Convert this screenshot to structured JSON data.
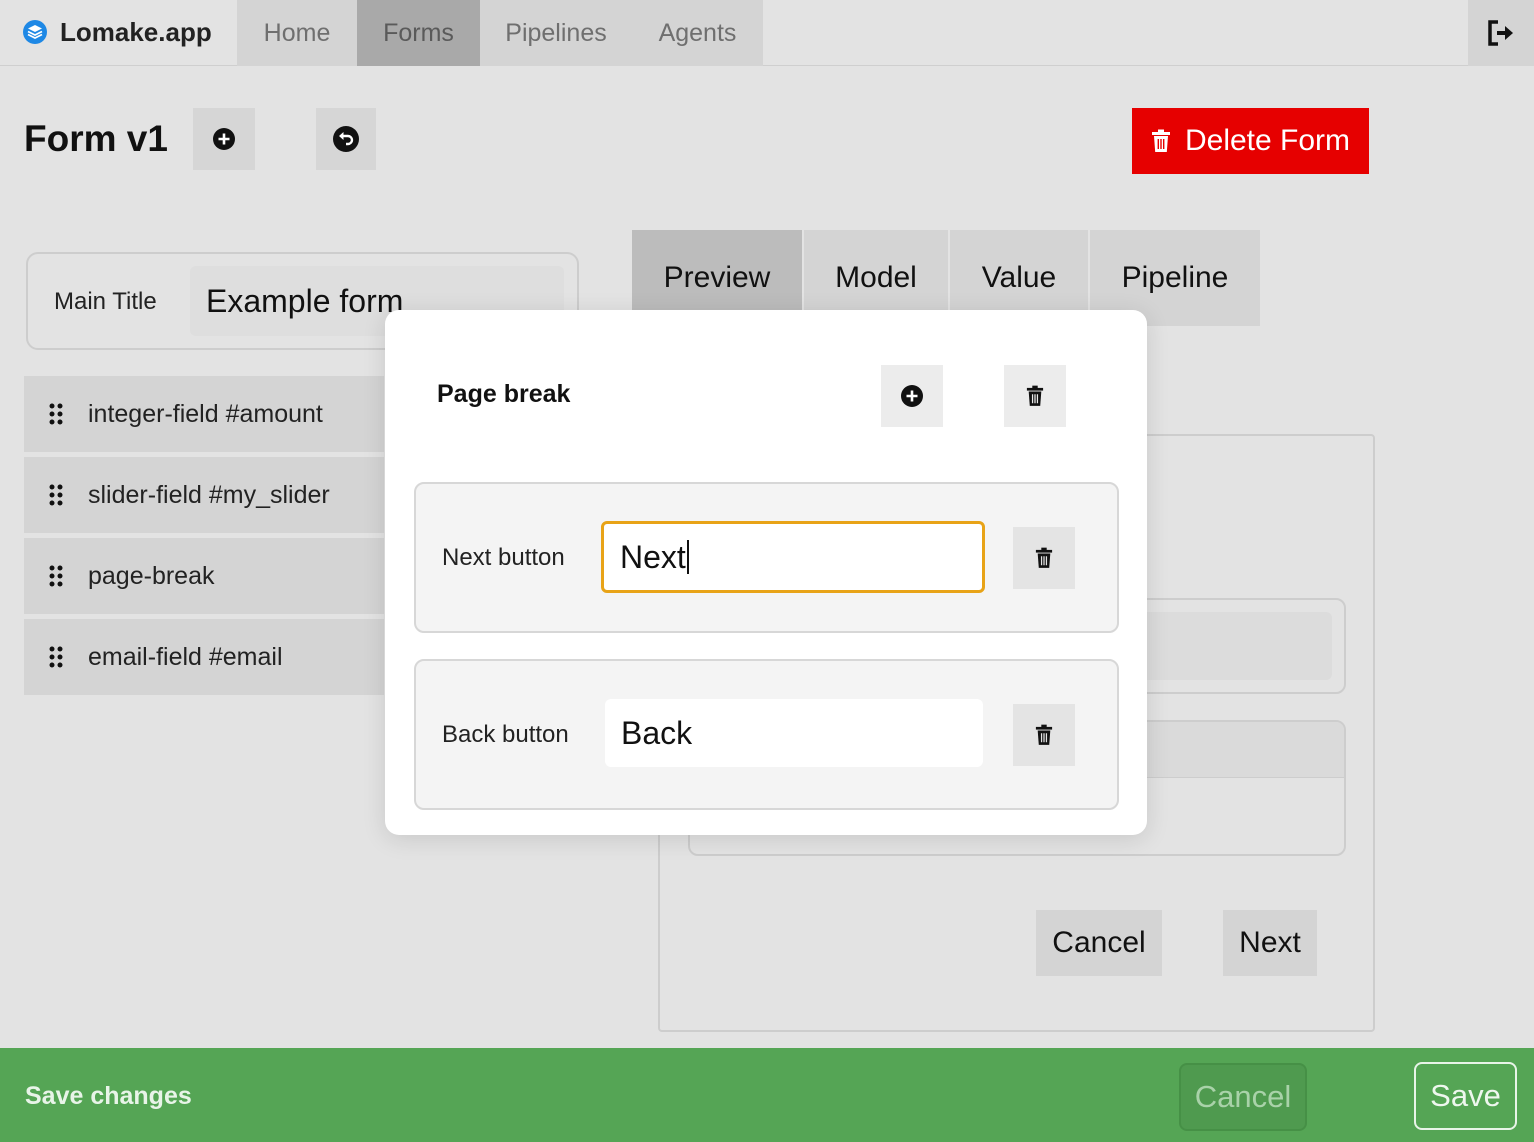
{
  "app": {
    "name": "Lomake.app",
    "logo_icon": "layers-icon"
  },
  "nav": {
    "items": [
      {
        "label": "Home",
        "active": false
      },
      {
        "label": "Forms",
        "active": true
      },
      {
        "label": "Pipelines",
        "active": false
      },
      {
        "label": "Agents",
        "active": false
      }
    ],
    "logout_icon": "logout-icon"
  },
  "header": {
    "title": "Form v1",
    "add_icon": "plus-circle-icon",
    "undo_icon": "undo-icon",
    "delete_label": "Delete Form",
    "delete_icon": "trash-icon",
    "delete_color": "#e60000"
  },
  "form": {
    "main_title_label": "Main Title",
    "main_title_value": "Example form",
    "fields": [
      {
        "label": "integer-field #amount"
      },
      {
        "label": "slider-field #my_slider"
      },
      {
        "label": "page-break"
      },
      {
        "label": "email-field #email"
      }
    ]
  },
  "tabs": [
    {
      "label": "Preview",
      "active": true
    },
    {
      "label": "Model",
      "active": false
    },
    {
      "label": "Value",
      "active": false
    },
    {
      "label": "Pipeline",
      "active": false
    }
  ],
  "preview": {
    "cancel_label": "Cancel",
    "next_label": "Next"
  },
  "modal": {
    "title": "Page break",
    "next_row": {
      "label": "Next button",
      "value": "Next"
    },
    "back_row": {
      "label": "Back button",
      "value": "Back"
    },
    "focus_color": "#e8a317"
  },
  "bottom_bar": {
    "message": "Save changes",
    "cancel_label": "Cancel",
    "save_label": "Save",
    "color": "#55a555"
  }
}
